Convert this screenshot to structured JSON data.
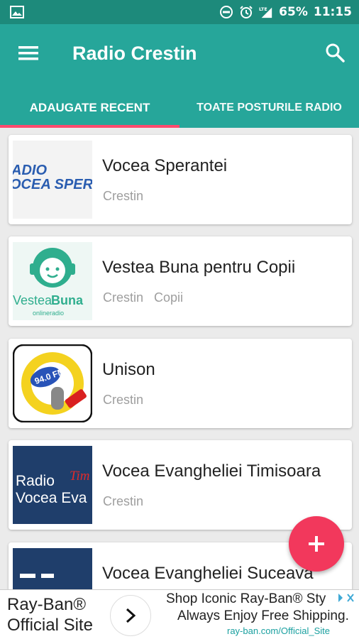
{
  "status_bar": {
    "battery": "65%",
    "time": "11:15",
    "network": "LTE"
  },
  "app_bar": {
    "title": "Radio Crestin",
    "menu_icon": "hamburger-menu-icon",
    "search_icon": "search-icon"
  },
  "tabs": [
    {
      "label": "ADAUGATE RECENT",
      "active": true
    },
    {
      "label": "TOATE POSTURILE RADIO",
      "active": false
    }
  ],
  "stations": [
    {
      "name": "Vocea Sperantei",
      "tags": [
        "Crestin"
      ],
      "logo_text": [
        "ADIO",
        "OCEA SPER"
      ]
    },
    {
      "name": "Vestea Buna pentru Copii",
      "tags": [
        "Crestin",
        "Copii"
      ],
      "logo_text": [
        "Vestea",
        "Buna",
        "onlineradio"
      ]
    },
    {
      "name": "Unison",
      "tags": [
        "Crestin"
      ],
      "logo_text": [
        "94.0 FM"
      ]
    },
    {
      "name": "Vocea Evangheliei Timisoara",
      "tags": [
        "Crestin"
      ],
      "logo_text": [
        "Radio",
        "Vocea Eva",
        "Tim"
      ]
    },
    {
      "name": "Vocea Evangheliei Suceava",
      "tags": [],
      "logo_text": []
    }
  ],
  "fab": {
    "icon": "plus-icon"
  },
  "ad": {
    "brand_line1": "Ray-Ban®",
    "brand_line2": "Official Site",
    "line1": "Shop Iconic Ray-Ban® Sty",
    "line2": "Always Enjoy Free Shipping.",
    "url": "ray-ban.com/Official_Site"
  },
  "colors": {
    "status_bar": "#1d8a7b",
    "app_bar": "#26a69a",
    "accent": "#f2385c",
    "tab_indicator": "#ff4a6e"
  }
}
